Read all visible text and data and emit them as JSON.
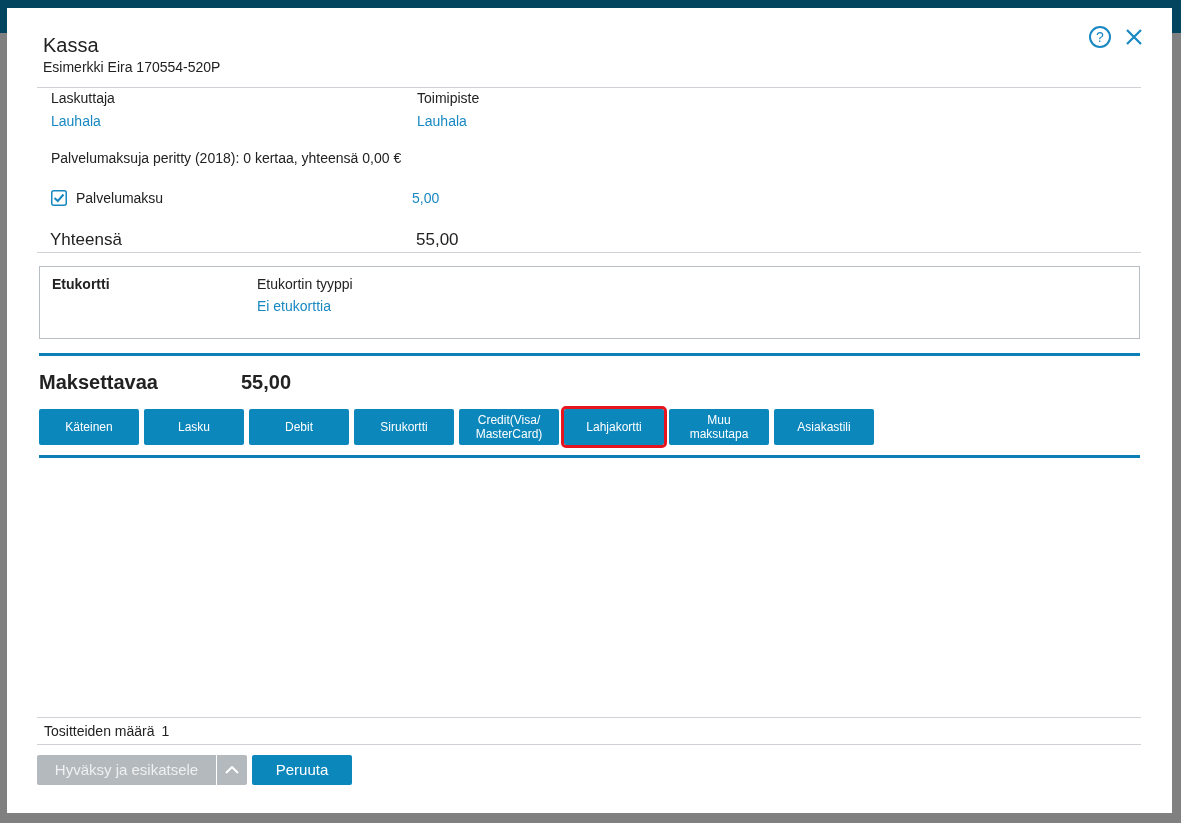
{
  "dialog": {
    "title": "Kassa",
    "subtitle": "Esimerkki Eira 170554-520P",
    "help": "?"
  },
  "fields": [
    {
      "label": "Laskuttaja",
      "value": "Lauhala"
    },
    {
      "label": "Toimipiste",
      "value": "Lauhala"
    }
  ],
  "service_fee_note": "Palvelumaksuja peritty (2018): 0 kertaa, yhteensä 0,00 €",
  "service_fee": {
    "label": "Palvelumaksu",
    "checked": true,
    "amount": "5,00"
  },
  "total": {
    "label": "Yhteensä",
    "value": "55,00"
  },
  "benefit_card": {
    "title": "Etukortti",
    "label": "Etukortin tyyppi",
    "value": "Ei etukorttia"
  },
  "amount_due": {
    "label": "Maksettavaa",
    "value": "55,00"
  },
  "payment_methods": [
    {
      "label": "Käteinen",
      "highlighted": false
    },
    {
      "label": "Lasku",
      "highlighted": false
    },
    {
      "label": "Debit",
      "highlighted": false
    },
    {
      "label": "Sirukortti",
      "highlighted": false
    },
    {
      "label": "Credit(Visa/\nMasterCard)",
      "highlighted": false
    },
    {
      "label": "Lahjakortti",
      "highlighted": true
    },
    {
      "label": "Muu\nmaksutapa",
      "highlighted": false
    },
    {
      "label": "Asiakastili",
      "highlighted": false
    }
  ],
  "voucher_count": {
    "label": "Tositteiden määrä",
    "value": "1"
  },
  "actions": [
    {
      "kind": "split",
      "label": "Hyväksy ja esikatsele",
      "disabled": true
    },
    {
      "kind": "primary",
      "label": "Peruuta",
      "disabled": false
    }
  ]
}
